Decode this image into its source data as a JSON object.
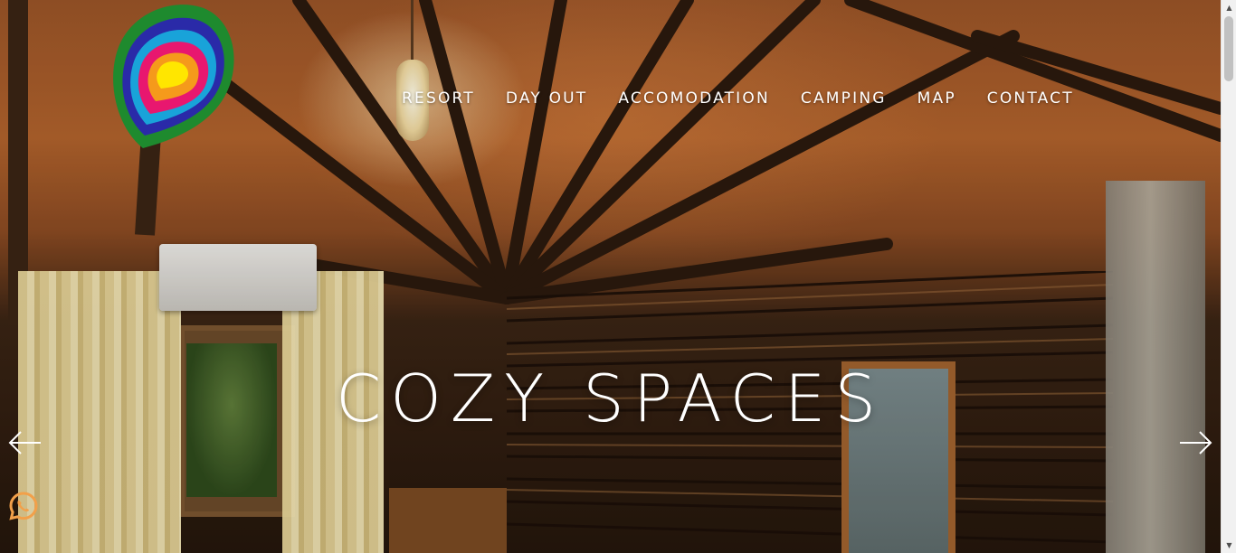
{
  "nav": {
    "items": [
      {
        "label": "RESORT"
      },
      {
        "label": "DAY OUT"
      },
      {
        "label": "ACCOMODATION"
      },
      {
        "label": "CAMPING"
      },
      {
        "label": "MAP"
      },
      {
        "label": "CONTACT"
      }
    ]
  },
  "hero": {
    "headline": "COZY SPACES"
  },
  "slider": {
    "prev_icon": "arrow-left-icon",
    "next_icon": "arrow-right-icon"
  },
  "widgets": {
    "whatsapp_icon": "whatsapp-icon",
    "whatsapp_color": "#f2a04a"
  },
  "logo": {
    "icon": "paisley-logo-icon",
    "colors": [
      "#1e8a2e",
      "#2a2aa8",
      "#19a3d9",
      "#e8176f",
      "#f59a1b",
      "#ffe600"
    ]
  }
}
